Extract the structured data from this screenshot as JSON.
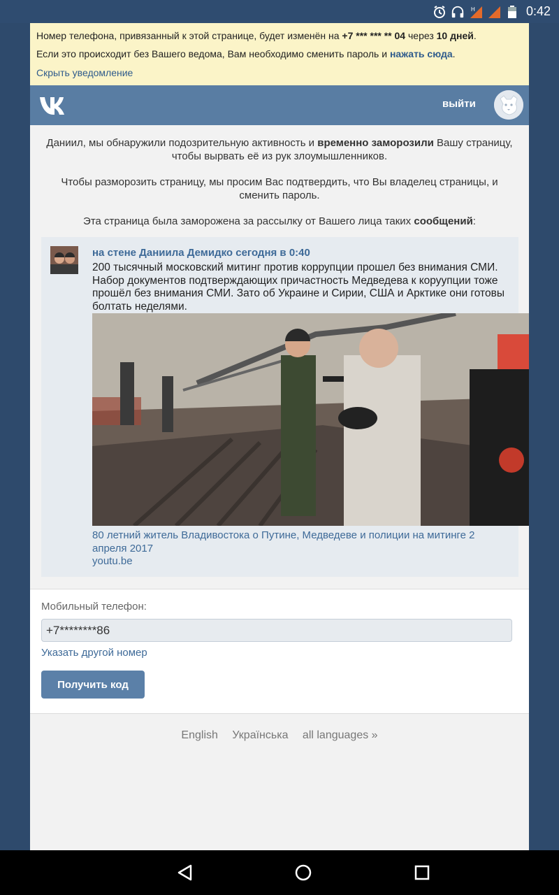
{
  "status_bar": {
    "time": "0:42",
    "icons": [
      "alarm-icon",
      "headphones-icon",
      "signal-h-icon",
      "signal-icon",
      "battery-icon"
    ]
  },
  "notice": {
    "line1_pre": "Номер телефона, привязанный к этой странице, будет изменён на ",
    "line1_phone": "+7 *** *** ** 04",
    "line1_mid": " через ",
    "line1_days": "10 дней",
    "line1_end": ".",
    "line2_pre": "Если это происходит без Вашего ведома, Вам необходимо сменить пароль и ",
    "line2_link": "нажать сюда",
    "line2_end": ".",
    "hide_link": "Скрыть уведомление"
  },
  "header": {
    "logout_label": "выйти",
    "colors": {
      "bar": "#597da3",
      "link": "#3e6a98"
    }
  },
  "messages": {
    "m1_pre": "Даниил, мы обнаружили подозрительную активность и ",
    "m1_bold": "временно заморозили",
    "m1_post": " Вашу страницу, чтобы вырвать её из рук злоумышленников.",
    "m2": "Чтобы разморозить страницу, мы просим Вас подтвердить, что Вы владелец страницы, и сменить пароль.",
    "m3_pre": "Эта страница была заморожена за рассылку от Вашего лица таких ",
    "m3_bold": "сообщений",
    "m3_post": ":"
  },
  "post": {
    "author": "на стене Даниила Демидко сегодня в 0:40",
    "text": "200 тысячный московский митинг против коррупции прошел без внимания СМИ. Набор документов подтверждающих причастность Медведева к коруупции тоже прошёл без внимания СМИ. Зато об Украине и Сирии, США и Арктике они готовы болтать неделями.",
    "video_caption": "80 летний житель Владивостока о Путине, Медведеве и полиции на митинге 2 апреля 2017",
    "domain": "youtu.be"
  },
  "form": {
    "label": "Мобильный телефон:",
    "phone_value": "+7********86",
    "other_number_link": "Указать другой номер",
    "submit_label": "Получить код"
  },
  "languages": [
    "English",
    "Українська",
    "all languages »"
  ]
}
